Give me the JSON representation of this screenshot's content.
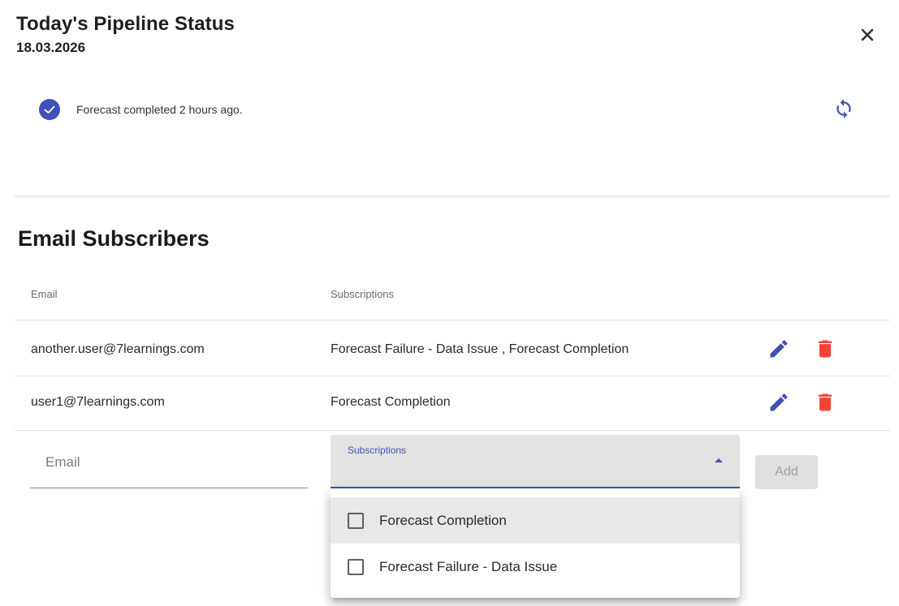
{
  "header": {
    "title": "Today's Pipeline Status",
    "date": "18.03.2026",
    "close_icon": "close-icon"
  },
  "status": {
    "icon": "check-circle-icon",
    "text": "Forecast completed 2 hours ago.",
    "refresh_icon": "refresh-icon",
    "check_color": "#3f51b5"
  },
  "subscribers": {
    "title": "Email Subscribers",
    "columns": {
      "email": "Email",
      "subscriptions": "Subscriptions"
    },
    "rows": [
      {
        "email": "another.user@7learnings.com",
        "subscriptions": "Forecast Failure - Data Issue , Forecast Completion"
      },
      {
        "email": "user1@7learnings.com",
        "subscriptions": "Forecast Completion"
      }
    ],
    "edit_color": "#3f51b5",
    "delete_color": "#f44336"
  },
  "form": {
    "email_placeholder": "Email",
    "subscriptions_label": "Subscriptions",
    "add_label": "Add"
  },
  "dropdown": {
    "options": [
      {
        "label": "Forecast Completion",
        "checked": false,
        "highlighted": true
      },
      {
        "label": "Forecast Failure - Data Issue",
        "checked": false,
        "highlighted": false
      }
    ]
  }
}
